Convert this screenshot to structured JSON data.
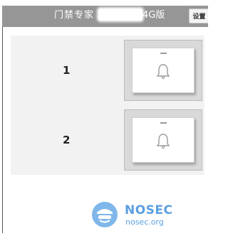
{
  "header": {
    "title_prefix": "门禁专家",
    "title_suffix": "4G版",
    "settings_label": "设置"
  },
  "doors": [
    {
      "number": "1"
    },
    {
      "number": "2"
    }
  ],
  "watermark": {
    "name": "NOSEC",
    "url": "nosec.org"
  },
  "colors": {
    "header_bg": "#969696",
    "watermark_blue": "#5a9fe0"
  }
}
